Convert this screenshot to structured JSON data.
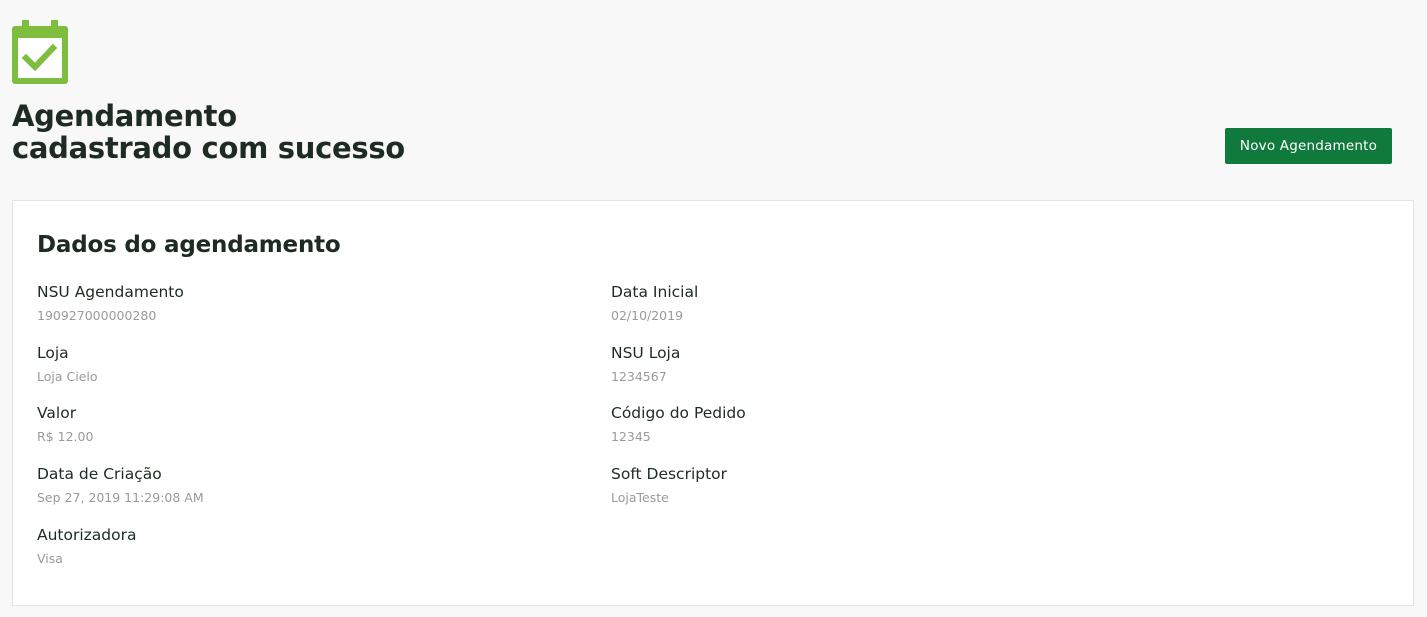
{
  "header": {
    "icon": "calendar-check-icon",
    "title_line1": "Agendamento",
    "title_line2": "cadastrado com sucesso",
    "new_button_label": "Novo Agendamento"
  },
  "colors": {
    "icon_green": "#7dbe3e",
    "button_green": "#0f7a3b",
    "title_dark": "#1d2b22",
    "value_gray": "#9a9a9a"
  },
  "details": {
    "title": "Dados do agendamento",
    "fields": [
      {
        "label": "NSU Agendamento",
        "value": "190927000000280"
      },
      {
        "label": "Data Inicial",
        "value": "02/10/2019"
      },
      {
        "label": "Loja",
        "value": "Loja Cielo"
      },
      {
        "label": "NSU Loja",
        "value": "1234567"
      },
      {
        "label": "Valor",
        "value": "R$ 12.00"
      },
      {
        "label": "Código do Pedido",
        "value": "12345"
      },
      {
        "label": "Data de Criação",
        "value": "Sep 27, 2019 11:29:08 AM"
      },
      {
        "label": "Soft Descriptor",
        "value": "LojaTeste"
      },
      {
        "label": "Autorizadora",
        "value": "Visa"
      }
    ]
  }
}
